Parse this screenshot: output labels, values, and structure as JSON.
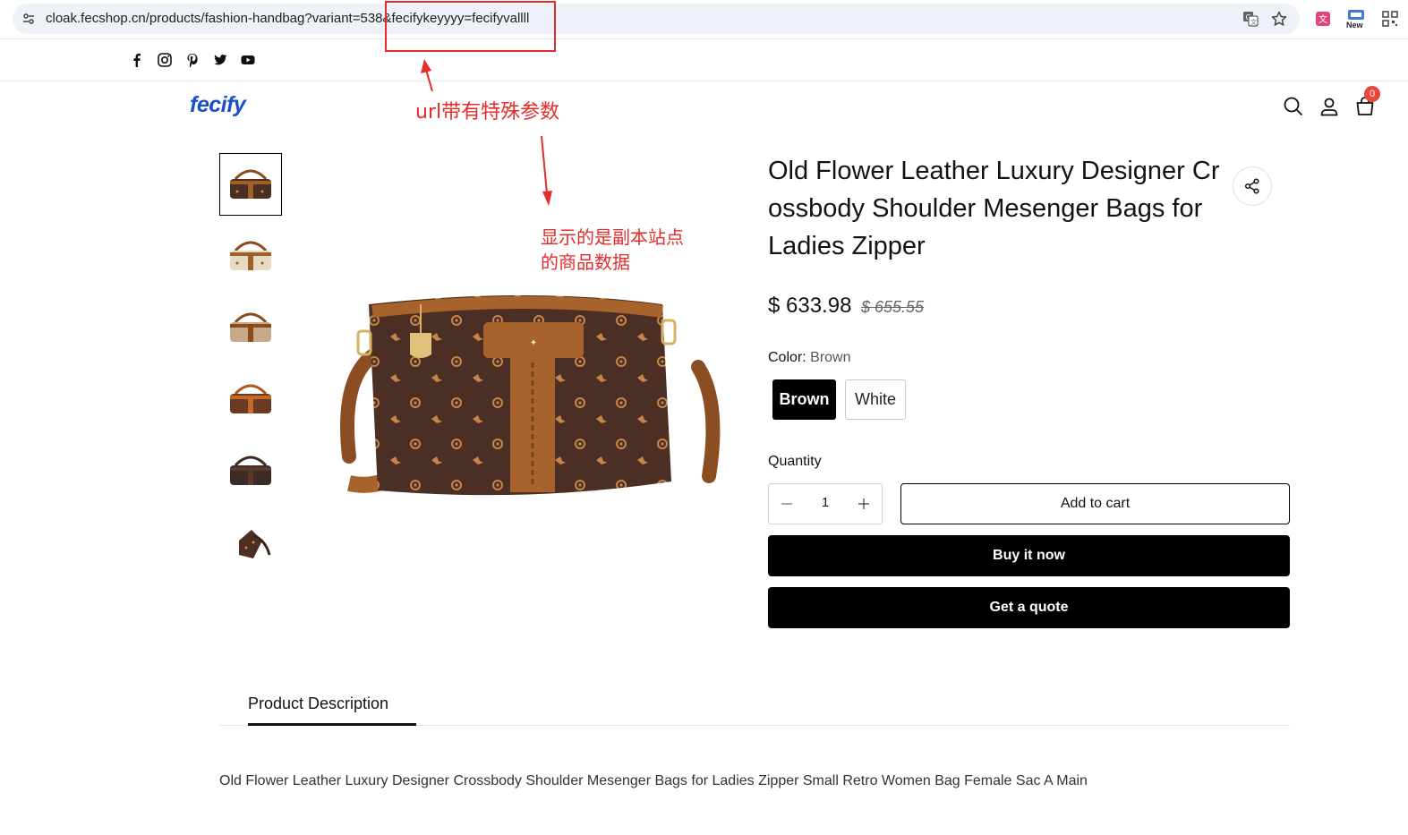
{
  "browser": {
    "url": "cloak.fecshop.cn/products/fashion-handbag?variant=538&fecifykeyyyy=fecifyvallll",
    "ext_new_label": "New"
  },
  "social": [
    "facebook-icon",
    "instagram-icon",
    "pinterest-icon",
    "twitter-icon",
    "youtube-icon"
  ],
  "header": {
    "logo": "fecify",
    "cart_count": "0"
  },
  "product": {
    "title": "Old Flower Leather Luxury Designer Crossbody Shoulder Mesenger Bags for Ladies Zipper",
    "price": "$ 633.98",
    "compare_price": "$ 655.55",
    "color_label": "Color:",
    "color_value": "Brown",
    "colors": [
      "Brown",
      "White"
    ],
    "quantity_label": "Quantity",
    "quantity": "1",
    "add_to_cart": "Add to cart",
    "buy_now": "Buy it now",
    "get_quote": "Get a quote"
  },
  "tabs": {
    "description_tab": "Product Description",
    "description_text": "Old Flower Leather Luxury Designer Crossbody Shoulder Mesenger Bags for Ladies Zipper Small Retro Women Bag Female Sac A Main"
  },
  "annotations": {
    "note1": "url带有特殊参数",
    "note2_line1": "显示的是副本站点",
    "note2_line2": "的商品数据"
  },
  "colors": {
    "accent_blue": "#1a4fc8",
    "annotation_red": "#e52b2b",
    "badge_red": "#e8463a",
    "button_black": "#000000"
  }
}
